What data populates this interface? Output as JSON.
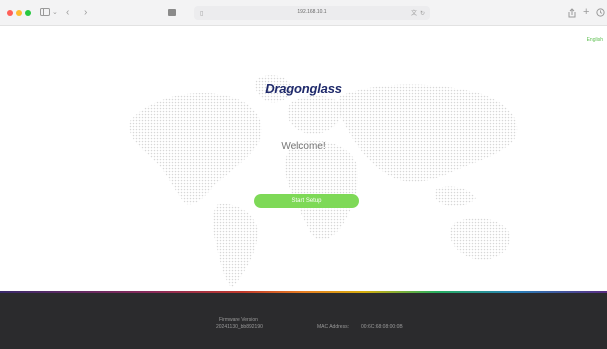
{
  "browser": {
    "address": "192.168.10.1"
  },
  "page": {
    "language": "English",
    "logo": "Dragonglass",
    "welcome": "Welcome!",
    "start_button": "Start Setup"
  },
  "footer": {
    "firmware_label": "Firmware Version",
    "firmware_value": "20241130_bb892190",
    "mac_label": "MAC Address:",
    "mac_value": "00:6C:68:08:00:0B"
  }
}
